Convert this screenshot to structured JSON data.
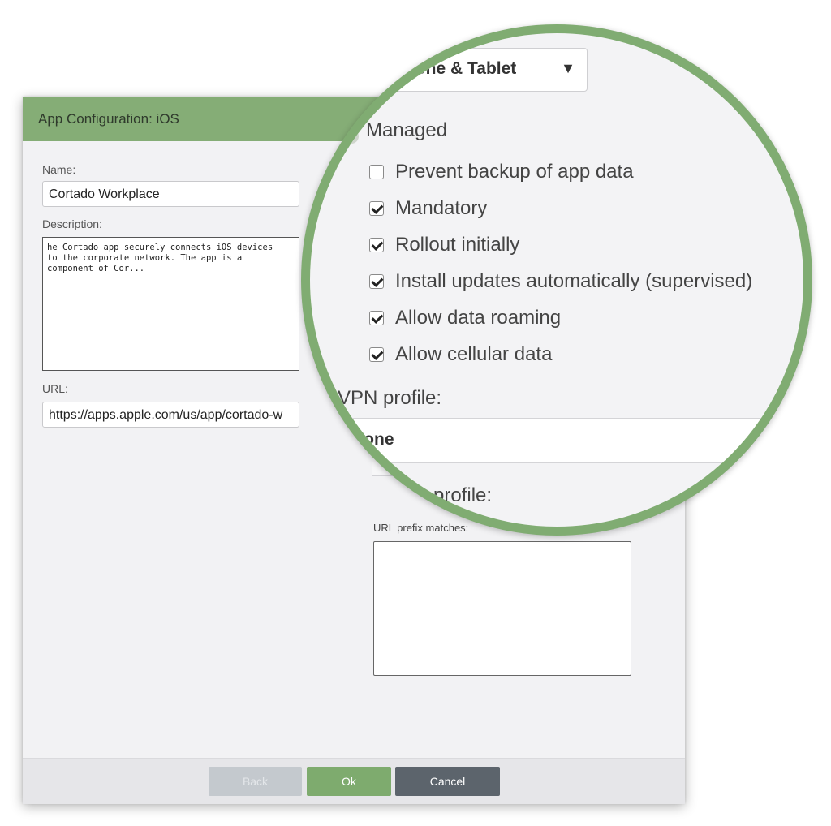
{
  "dialog": {
    "title": "App Configuration: iOS",
    "name_label": "Name:",
    "name_value": "Cortado Workplace",
    "description_label": "Description:",
    "description_value": "he Cortado app securely connects iOS devices\nto the corporate network. The app is a\ncomponent of Cor...",
    "url_label": "URL:",
    "url_value": "https://apps.apple.com/us/app/cortado-w",
    "url_prefix_label": "URL prefix matches:",
    "buttons": {
      "back": "Back",
      "ok": "Ok",
      "cancel": "Cancel"
    }
  },
  "magnifier": {
    "device_type": "hone & Tablet",
    "managed_label": "Managed",
    "options": [
      {
        "label": "Prevent backup of app data",
        "checked": false
      },
      {
        "label": "Mandatory",
        "checked": true
      },
      {
        "label": "Rollout initially",
        "checked": true
      },
      {
        "label": "Install updates automatically (supervised)",
        "checked": true
      },
      {
        "label": "Allow data roaming",
        "checked": true
      },
      {
        "label": "Allow cellular data",
        "checked": true
      }
    ],
    "vpn_label": "VPN profile:",
    "vpn_value": "None",
    "sso_label": "n-On profile:"
  },
  "colors": {
    "accent": "#85ad76",
    "ok": "#7eab6e",
    "cancel": "#5c646c",
    "back": "#c4c9ce"
  }
}
